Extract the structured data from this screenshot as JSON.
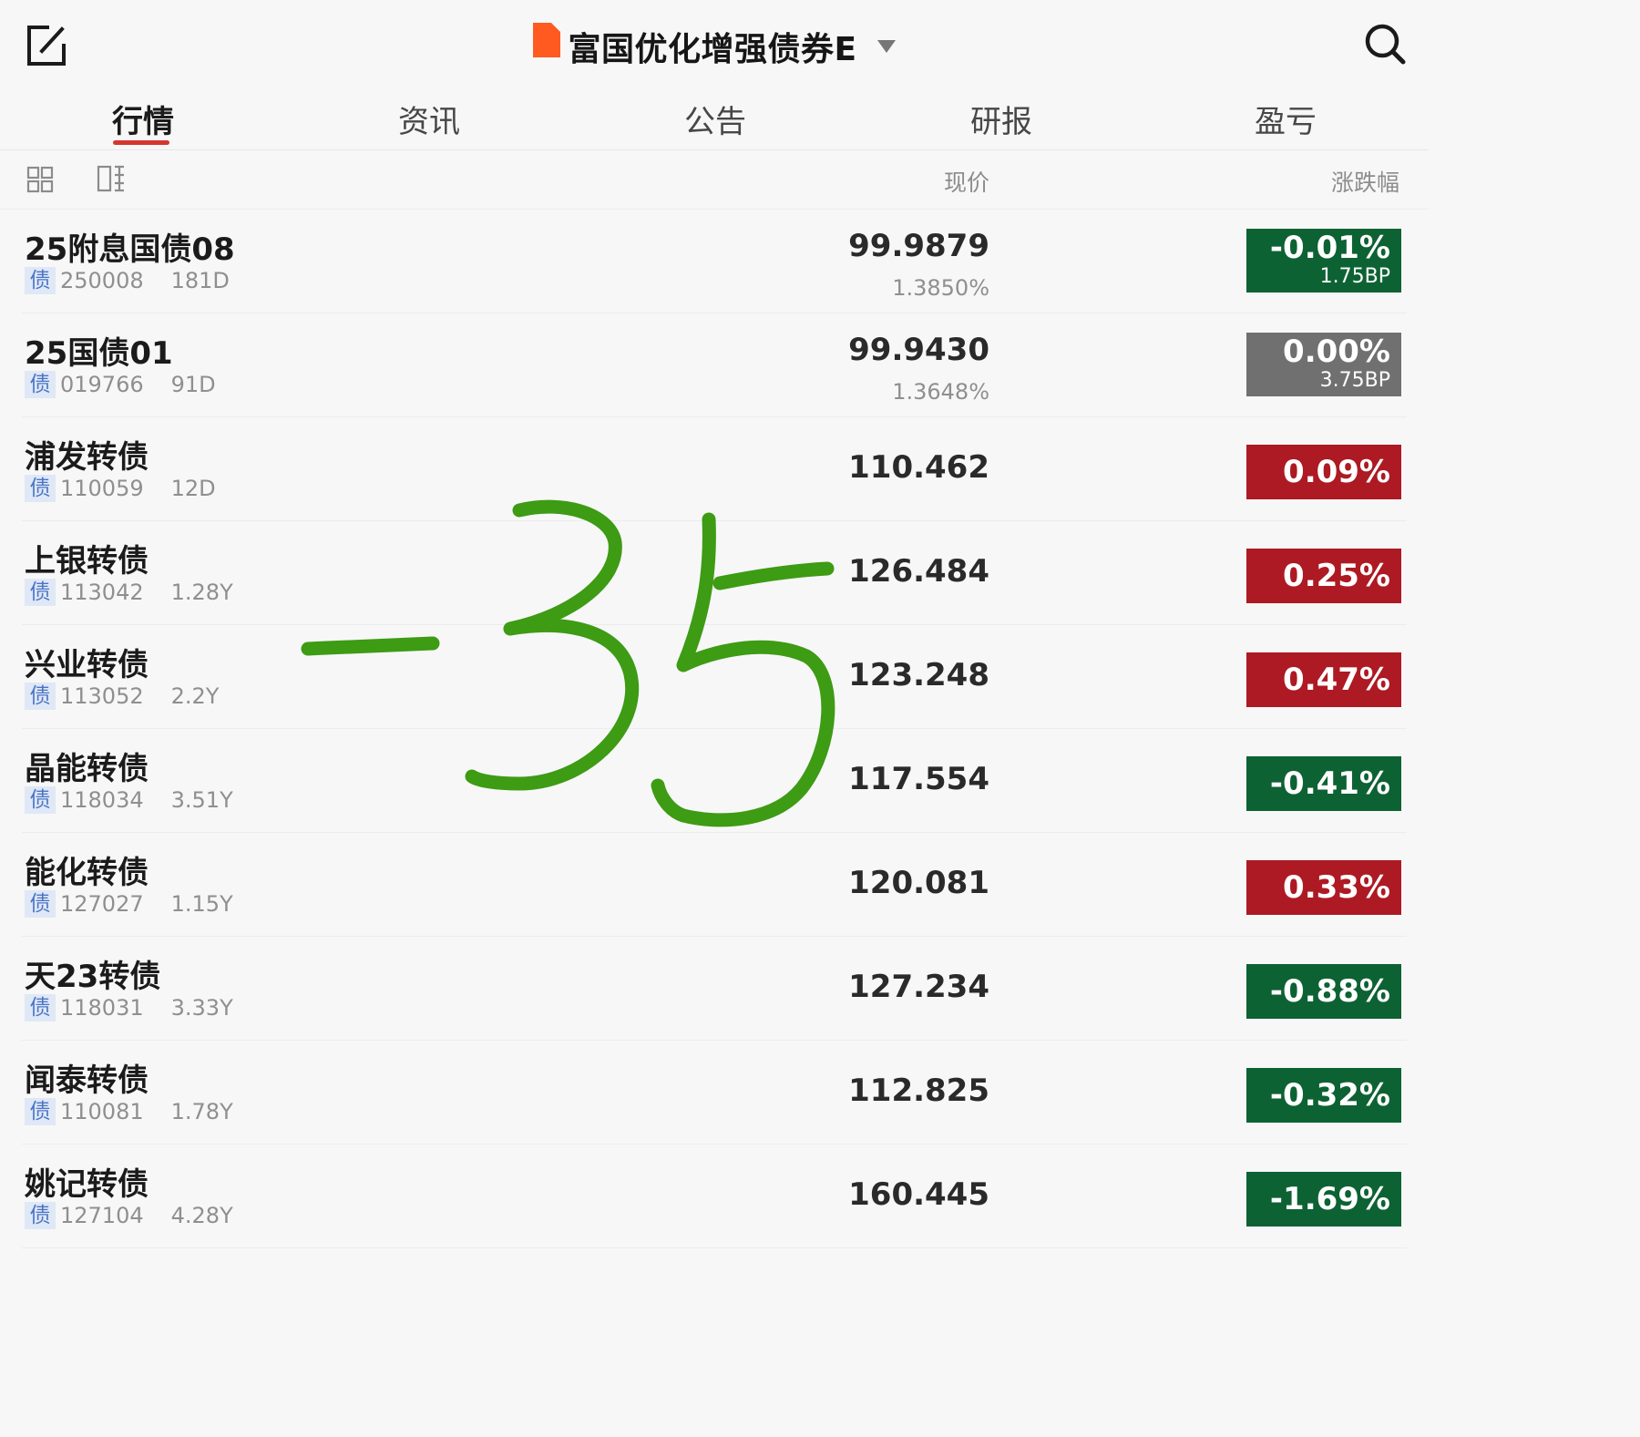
{
  "header": {
    "title": "富国优化增强债券E"
  },
  "tabs": [
    {
      "label": "行情",
      "active": true
    },
    {
      "label": "资讯",
      "active": false
    },
    {
      "label": "公告",
      "active": false
    },
    {
      "label": "研报",
      "active": false
    },
    {
      "label": "盈亏",
      "active": false
    }
  ],
  "columns": {
    "price": "现价",
    "change": "涨跌幅"
  },
  "rows": [
    {
      "name": "25附息国债08",
      "tag": "债",
      "code": "250008",
      "term": "181D",
      "price": "99.9879",
      "yield": "1.3850%",
      "change": "-0.01%",
      "change_sub": "1.75BP",
      "status": "down"
    },
    {
      "name": "25国债01",
      "tag": "债",
      "code": "019766",
      "term": "91D",
      "price": "99.9430",
      "yield": "1.3648%",
      "change": "0.00%",
      "change_sub": "3.75BP",
      "status": "flat"
    },
    {
      "name": "浦发转债",
      "tag": "债",
      "code": "110059",
      "term": "12D",
      "price": "110.462",
      "change": "0.09%",
      "status": "up"
    },
    {
      "name": "上银转债",
      "tag": "债",
      "code": "113042",
      "term": "1.28Y",
      "price": "126.484",
      "change": "0.25%",
      "status": "up"
    },
    {
      "name": "兴业转债",
      "tag": "债",
      "code": "113052",
      "term": "2.2Y",
      "price": "123.248",
      "change": "0.47%",
      "status": "up"
    },
    {
      "name": "晶能转债",
      "tag": "债",
      "code": "118034",
      "term": "3.51Y",
      "price": "117.554",
      "change": "-0.41%",
      "status": "down"
    },
    {
      "name": "能化转债",
      "tag": "债",
      "code": "127027",
      "term": "1.15Y",
      "price": "120.081",
      "change": "0.33%",
      "status": "up"
    },
    {
      "name": "天23转债",
      "tag": "债",
      "code": "118031",
      "term": "3.33Y",
      "price": "127.234",
      "change": "-0.88%",
      "status": "down"
    },
    {
      "name": "闻泰转债",
      "tag": "债",
      "code": "110081",
      "term": "1.78Y",
      "price": "112.825",
      "change": "-0.32%",
      "status": "down"
    },
    {
      "name": "姚记转债",
      "tag": "债",
      "code": "127104",
      "term": "4.28Y",
      "price": "160.445",
      "change": "-1.69%",
      "status": "down"
    }
  ],
  "annotation": {
    "text": "-35"
  },
  "icons": {
    "edit": "edit-icon",
    "search": "search-icon",
    "badge": "bookmark-icon",
    "grid": "grid-view-icon",
    "split": "split-view-icon",
    "caret": "chevron-down-icon"
  },
  "colors": {
    "up": "#ad1a23",
    "down": "#0d6233",
    "flat": "#707070",
    "accent": "#d5362e",
    "badge": "#ff5a1f",
    "annotation": "#3d9b14"
  }
}
